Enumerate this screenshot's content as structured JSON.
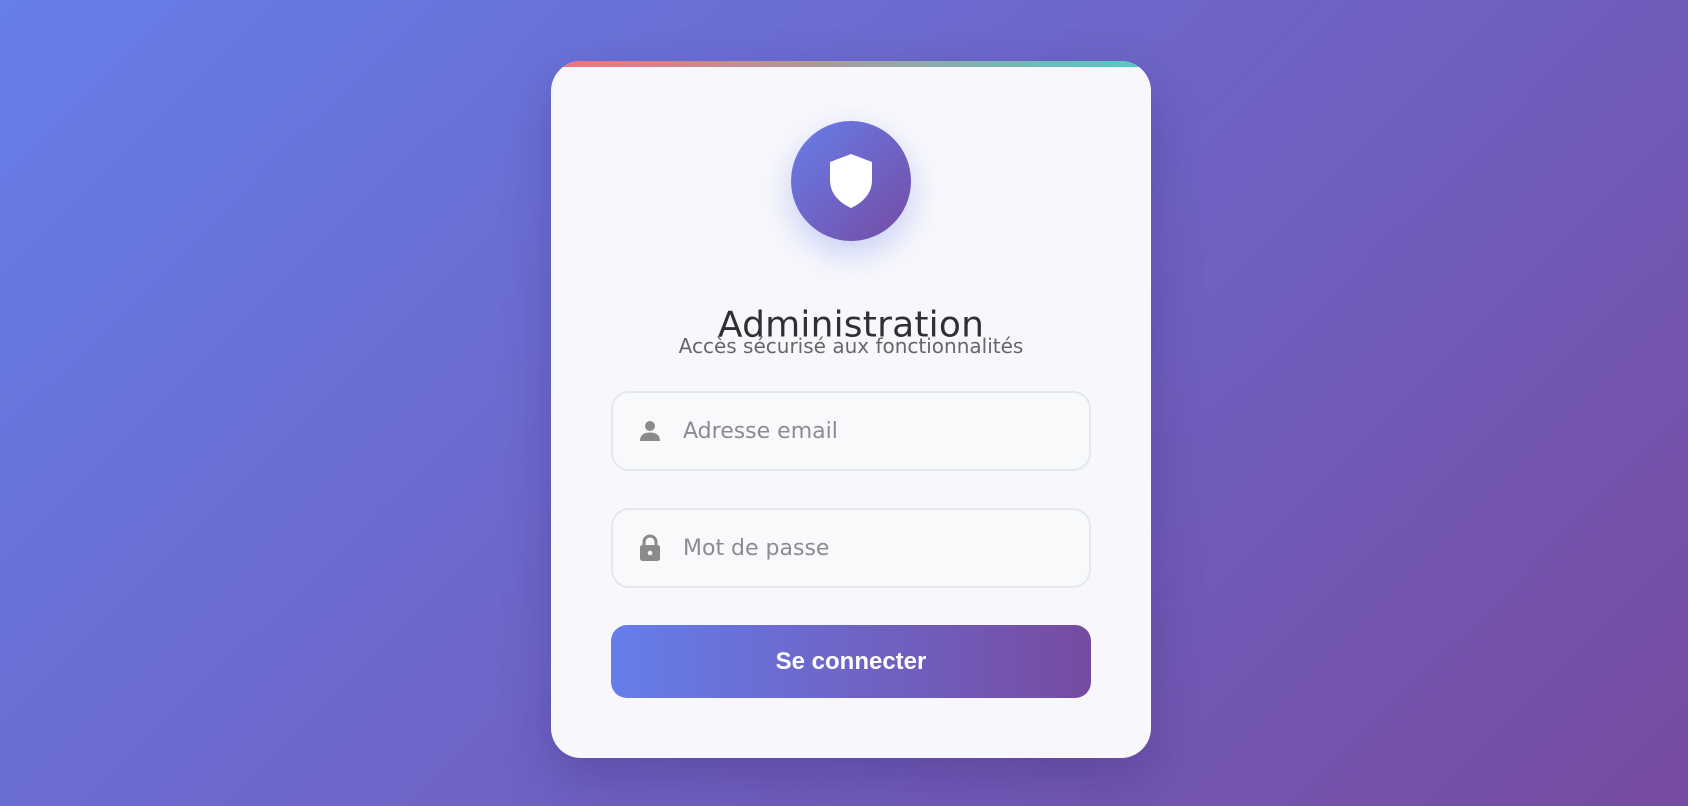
{
  "colors": {
    "background_start": "#667eea",
    "background_end": "#764ba2",
    "card_background": "#f8f8fc",
    "accent_bar": [
      "#f7707e",
      "#4ecdc4"
    ],
    "icon_gray": "#8a8a8a"
  },
  "card": {
    "logo_icon": "shield-icon",
    "title": "Administration",
    "subtitle": "Accès sécurisé aux fonctionnalités"
  },
  "form": {
    "email": {
      "icon": "user-icon",
      "placeholder": "Adresse email",
      "value": ""
    },
    "password": {
      "icon": "lock-icon",
      "placeholder": "Mot de passe",
      "value": ""
    },
    "submit_label": "Se connecter"
  }
}
